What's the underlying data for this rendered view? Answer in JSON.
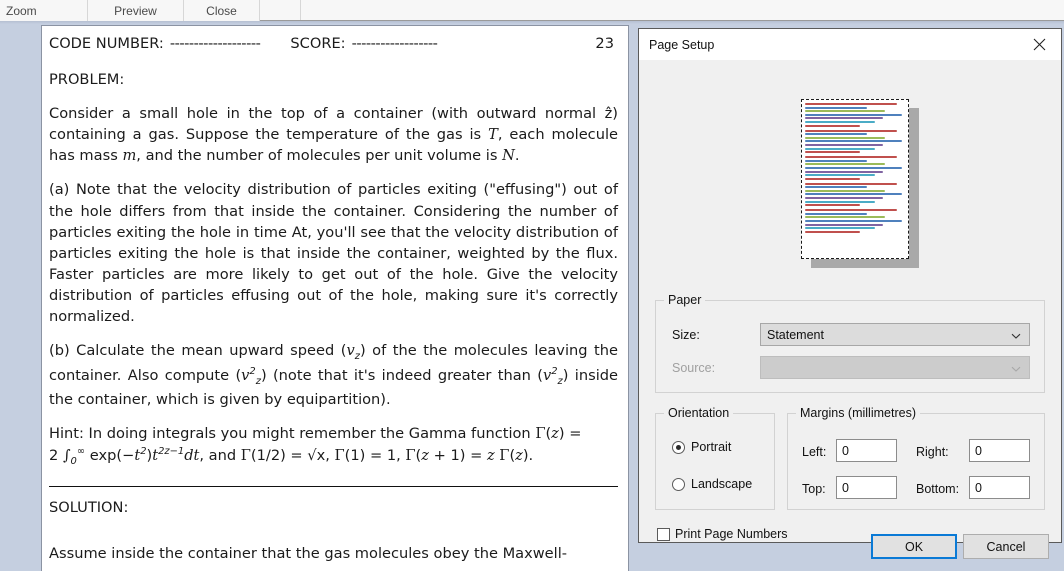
{
  "toolbar": {
    "items": [
      {
        "label": "Zoom",
        "name": "toolbar-zoom"
      },
      {
        "label": "Preview",
        "name": "toolbar-preview"
      },
      {
        "label": "Close",
        "name": "toolbar-close"
      }
    ]
  },
  "document": {
    "header": {
      "code_label": "CODE NUMBER:",
      "code_dashes": "-------------------",
      "score_label": "SCORE:",
      "score_dashes": "------------------",
      "page_number": "23"
    },
    "problem_label": "PROBLEM:",
    "paragraph_intro_1": "Consider a small hole in the top of a container (with outward normal ẑ) containing a gas. Suppose the temperature of the gas is ",
    "paragraph_intro_T": "T",
    "paragraph_intro_2": ", each molecule has mass ",
    "paragraph_intro_m": "m",
    "paragraph_intro_3": ", and the number of molecules per unit volume is ",
    "paragraph_intro_N": "N",
    "paragraph_intro_4": ".",
    "part_a": "(a) Note that the velocity distribution of particles exiting (\"effusing\") out of the hole differs from that inside the container. Considering the number of particles exiting the hole in time At, you'll see that the velocity distribution of particles exiting the hole is that inside the container, weighted by the flux. Faster particles are more likely to get out of the hole. Give the velocity distribution of particles effusing out of the hole, making sure it's correctly normalized.",
    "part_b_1": "(b) Calculate the mean upward speed (",
    "part_b_vz": "v",
    "part_b_z": "z",
    "part_b_2": ") of the the molecules leaving the container. Also compute (",
    "part_b_3": ") (note that it's indeed greater than (",
    "part_b_4": ") inside the container, which is given by equipartition).",
    "hint_line1_a": "Hint: In doing integrals you might remember the Gamma function ",
    "hint_gamma": "Γ",
    "hint_line1_b": "(",
    "hint_z": "z",
    "hint_line1_c": ") =",
    "hint_line2_a": "2 ",
    "hint_integral": "∫",
    "hint_sub0": "0",
    "hint_supinf": "∞",
    "hint_line2_b": " exp(−",
    "hint_t": "t",
    "hint_sup2": "2",
    "hint_line2_c": ")",
    "hint_line2_d": "2z−1",
    "hint_dt": "dt",
    "hint_line2_e": ", and ",
    "hint_half": "(1/2) = √x, ",
    "hint_one": "(1) = 1, ",
    "hint_zplus": "(",
    "hint_zplus2": " + 1) = ",
    "hint_zfinal": " ",
    "hint_end": "(",
    "hint_end2": ").",
    "solution_label": "SOLUTION:",
    "solution_first_line": "Assume inside the container that the gas molecules obey the Maxwell-"
  },
  "dialog": {
    "title": "Page Setup",
    "close_icon": "✕",
    "paper": {
      "legend": "Paper",
      "size_label": "Size:",
      "size_value": "Statement",
      "source_label": "Source:",
      "source_value": ""
    },
    "orientation": {
      "legend": "Orientation",
      "portrait_label": "Portrait",
      "landscape_label": "Landscape",
      "selected": "Portrait"
    },
    "margins": {
      "legend": "Margins (millimetres)",
      "left_label": "Left:",
      "left_value": "0",
      "right_label": "Right:",
      "right_value": "0",
      "top_label": "Top:",
      "top_value": "0",
      "bottom_label": "Bottom:",
      "bottom_value": "0"
    },
    "print_page_numbers_label": "Print Page Numbers",
    "print_page_numbers_checked": false,
    "ok_label": "OK",
    "cancel_label": "Cancel",
    "ok_focus_color": "#0a7ad6"
  },
  "preview": {
    "line_colors": [
      "#c0504d",
      "#4f81bd",
      "#9bbb59",
      "#4f81bd",
      "#8064a2",
      "#4bacc6",
      "#c0504d"
    ]
  },
  "colors": {
    "desktop_background": "#c5cfe0",
    "toolbar_background": "#f7f7f7",
    "dialog_background": "#f0f0f0",
    "page_background": "#ffffff"
  }
}
